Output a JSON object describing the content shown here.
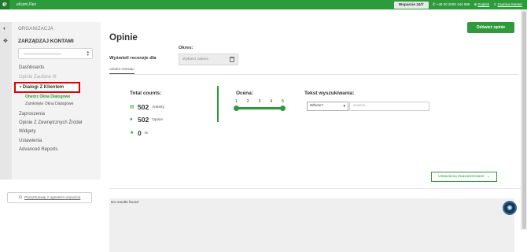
{
  "topbar": {
    "logo_letter": "e",
    "app_name": "eKomi Flex",
    "support_label": "Wsparcie 24/7",
    "phone": "+48 30 2000 444 999",
    "language": "English",
    "user": "Zaufane Master"
  },
  "sidebar": {
    "org_label": "ORGANIZACJA",
    "manage_label": "ZARZĄDZAJ KONTAMI",
    "nav": {
      "dashboards": "Dashboards",
      "partial": "Opinie Zaufane III",
      "active": "Dialogi Z Klientem",
      "open_dialogs": "Otwórz Okna Dialogowe",
      "closed_dialogs": "Zamknięte Okna Dialogowe",
      "invitations": "Zaproszenia",
      "external": "Opinie Z Zewnętrznych Źródeł",
      "widgets": "Widgety",
      "settings": "Ustawienia",
      "reports": "Advanced Reports"
    },
    "agent_button": "Porozmawiaj z agentem wsparcia"
  },
  "main": {
    "title": "Opinie",
    "add_button": "Odśwież opinie",
    "show_label": "Wyświetl recenzje dla",
    "period_label": "Okres:",
    "period_placeholder": "Wybierz zakres",
    "tab_label": "ostatni miesiąc",
    "totals": {
      "title": "Total counts:",
      "reviews_count": "502",
      "reviews_unit": "Ankiety",
      "opinions_count": "502",
      "opinions_unit": "Opinie",
      "rating_value": "0",
      "rating_unit": "/5"
    },
    "rating": {
      "title": "Ocena:",
      "labels": [
        "1",
        "2",
        "3",
        "4",
        "5"
      ],
      "min": 1,
      "max": 5
    },
    "search": {
      "title": "Tekst wyszukiwania:",
      "where_value": "Where?",
      "placeholder": "Search..."
    },
    "advanced_button": "Ustawienia Zaawansowane",
    "no_results": "No results found"
  }
}
